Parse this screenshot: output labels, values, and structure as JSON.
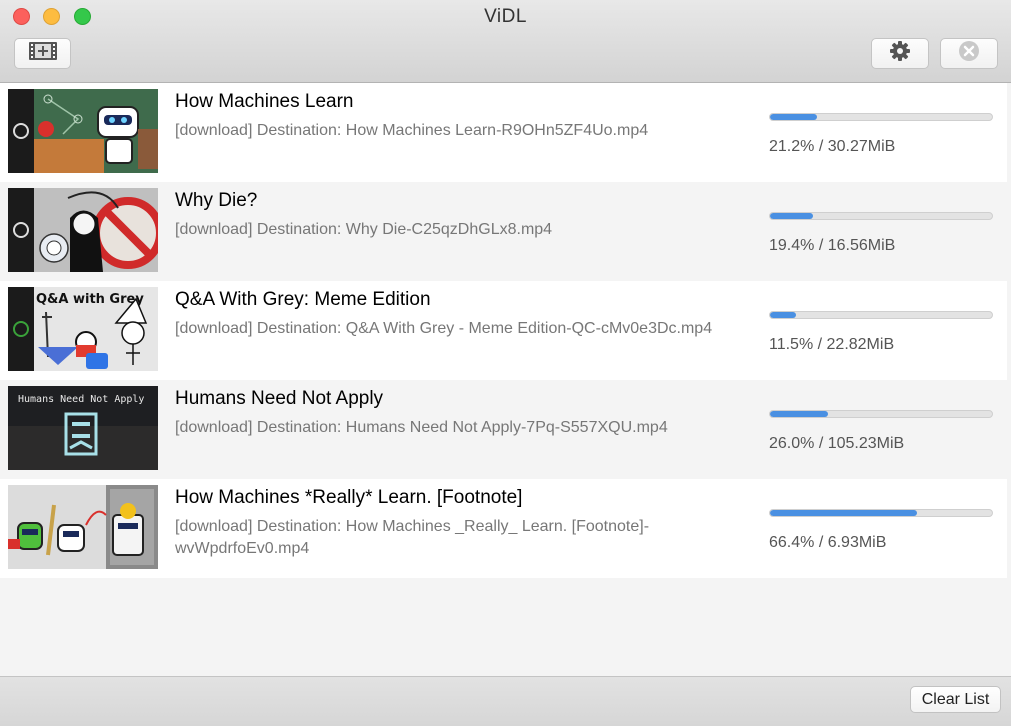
{
  "window": {
    "title": "ViDL"
  },
  "toolbar": {
    "add_icon": "film-add-icon",
    "settings_icon": "gear-icon",
    "cancel_icon": "cancel-circle-icon"
  },
  "downloads": [
    {
      "title": "How Machines Learn",
      "destination": "[download] Destination: How Machines Learn-R9OHn5ZF4Uo.mp4",
      "progress": 0.212,
      "progress_text": "21.2% / 30.27MiB",
      "thumbnail_icon": "robot-teacher-thumbnail"
    },
    {
      "title": "Why Die?",
      "destination": "[download] Destination: Why Die-C25qzDhGLx8.mp4",
      "progress": 0.194,
      "progress_text": "19.4% / 16.56MiB",
      "thumbnail_icon": "grim-reaper-thumbnail"
    },
    {
      "title": "Q&A With Grey: Meme Edition",
      "destination": "[download] Destination: Q&A With Grey - Meme Edition-QC-cMv0e3Dc.mp4",
      "progress": 0.115,
      "progress_text": "11.5% / 22.82MiB",
      "thumbnail_icon": "qa-with-grey-thumbnail",
      "thumbnail_text": "Q&A with Grey"
    },
    {
      "title": "Humans Need Not Apply",
      "destination": "[download] Destination: Humans Need Not Apply-7Pq-S557XQU.mp4",
      "progress": 0.26,
      "progress_text": "26.0% / 105.23MiB",
      "thumbnail_icon": "humans-need-not-apply-thumbnail",
      "thumbnail_text": "Humans Need Not Apply"
    },
    {
      "title": "How Machines *Really* Learn.  [Footnote]",
      "destination": "[download] Destination: How Machines _Really_ Learn.  [Footnote]-wvWpdrfoEv0.mp4",
      "progress": 0.664,
      "progress_text": "66.4% / 6.93MiB",
      "thumbnail_icon": "robots-footnote-thumbnail"
    }
  ],
  "footer": {
    "clear_label": "Clear List"
  },
  "colors": {
    "progress_fill": "#4a90e2",
    "row_alt": "#f4f4f4"
  }
}
